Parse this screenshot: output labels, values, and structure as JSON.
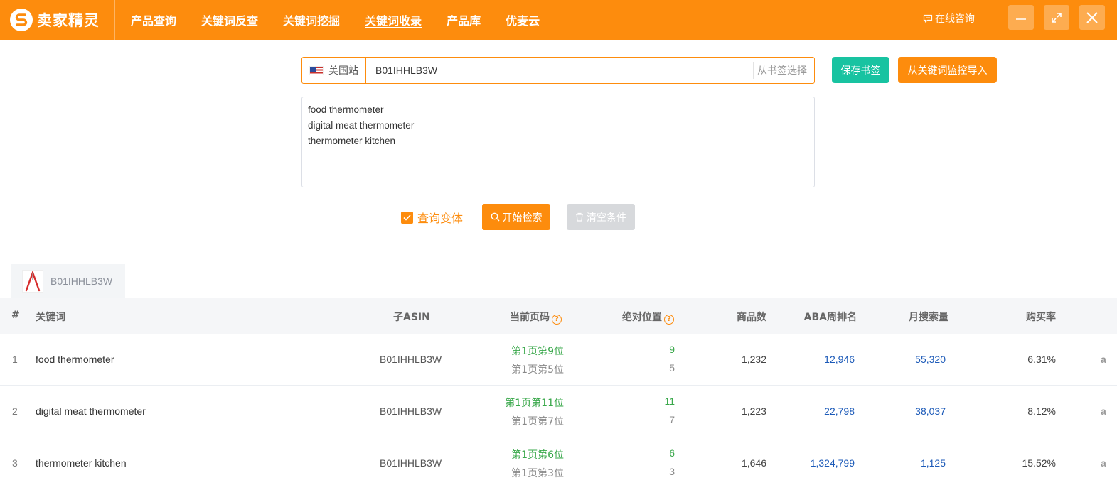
{
  "header": {
    "logo_text": "卖家精灵",
    "nav": [
      {
        "label": "产品查询",
        "active": false
      },
      {
        "label": "关键词反查",
        "active": false
      },
      {
        "label": "关键词挖掘",
        "active": false
      },
      {
        "label": "关键词收录",
        "active": true
      },
      {
        "label": "产品库",
        "active": false
      },
      {
        "label": "优麦云",
        "active": false
      }
    ],
    "consult": "在线咨询"
  },
  "search": {
    "site": "美国站",
    "asin_value": "B01IHHLB3W",
    "bookmark_select": "从书签选择",
    "save_bookmark": "保存书签",
    "import_from_monitor": "从关键词监控导入",
    "keywords": [
      "food thermometer",
      "digital meat thermometer",
      "thermometer kitchen"
    ],
    "query_variants_label": "查询变体",
    "query_variants_checked": true,
    "start_search": "开始检索",
    "clear_conditions": "清空条件"
  },
  "product_tab": {
    "asin": "B01IHHLB3W"
  },
  "table": {
    "headers": {
      "index": "#",
      "keyword": "关键词",
      "child_asin": "子ASIN",
      "current_page": "当前页码",
      "absolute_position": "绝对位置",
      "product_count": "商品数",
      "aba_rank": "ABA周排名",
      "monthly_search": "月搜索量",
      "purchase_rate": "购买率"
    },
    "rows": [
      {
        "index": "1",
        "keyword": "food thermometer",
        "asin": "B01IHHLB3W",
        "page_ad": "第1页第9位",
        "page_natural": "第1页第5位",
        "pos_ad": "9",
        "pos_natural": "5",
        "count": "1,232",
        "aba": "12,946",
        "monthly": "55,320",
        "rate": "6.31%",
        "amz": "a"
      },
      {
        "index": "2",
        "keyword": "digital meat thermometer",
        "asin": "B01IHHLB3W",
        "page_ad": "第1页第11位",
        "page_natural": "第1页第7位",
        "pos_ad": "11",
        "pos_natural": "7",
        "count": "1,223",
        "aba": "22,798",
        "monthly": "38,037",
        "rate": "8.12%",
        "amz": "a"
      },
      {
        "index": "3",
        "keyword": "thermometer kitchen",
        "asin": "B01IHHLB3W",
        "page_ad": "第1页第6位",
        "page_natural": "第1页第3位",
        "pos_ad": "6",
        "pos_natural": "3",
        "count": "1,646",
        "aba": "1,324,799",
        "monthly": "1,125",
        "rate": "15.52%",
        "amz": "a"
      }
    ]
  }
}
